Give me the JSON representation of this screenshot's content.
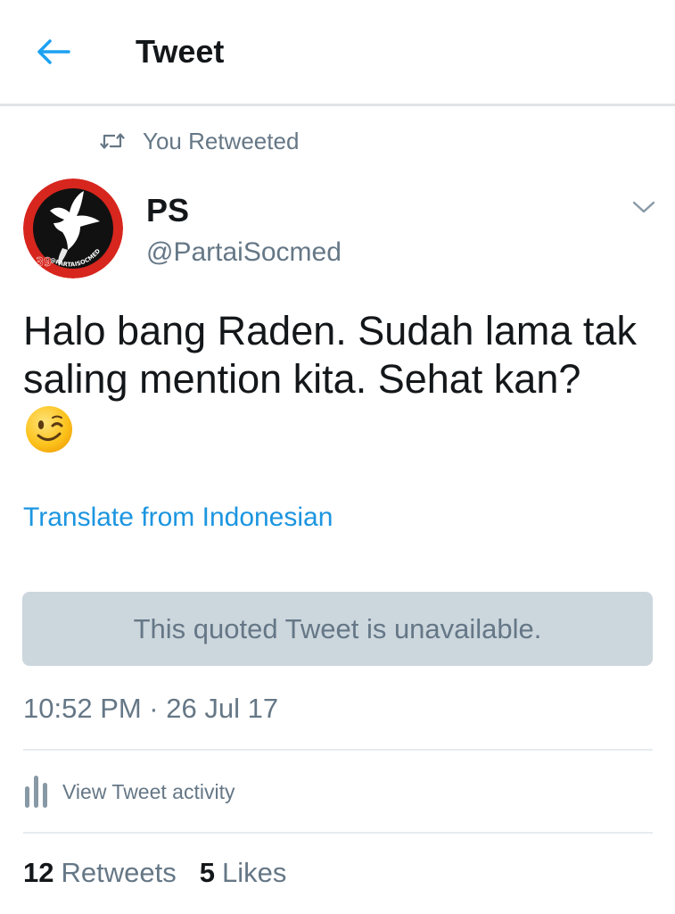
{
  "header": {
    "title": "Tweet",
    "back_icon": "back-arrow-icon",
    "accent_color": "#1da1f2"
  },
  "social_context": {
    "icon": "retweet-icon",
    "label": "You Retweeted"
  },
  "author": {
    "name": "PS",
    "handle": "@PartaiSocmed",
    "avatar_text": "@PARTAISOCMED"
  },
  "tweet": {
    "text": "Halo bang Raden. Sudah lama tak saling mention kita. Sehat kan?",
    "emoji": "winking-face",
    "translate_label": "Translate from Indonesian",
    "quoted_unavailable": "This quoted Tweet is unavailable.",
    "timestamp": "10:52 PM · 26 Jul 17"
  },
  "activity": {
    "icon": "bar-chart-icon",
    "label": "View Tweet activity"
  },
  "stats": {
    "retweets_count": "12",
    "retweets_label": "Retweets",
    "likes_count": "5",
    "likes_label": "Likes"
  },
  "colors": {
    "link": "#1b95e0",
    "secondary_text": "#657786",
    "quoted_bg": "#ccd6dd"
  }
}
